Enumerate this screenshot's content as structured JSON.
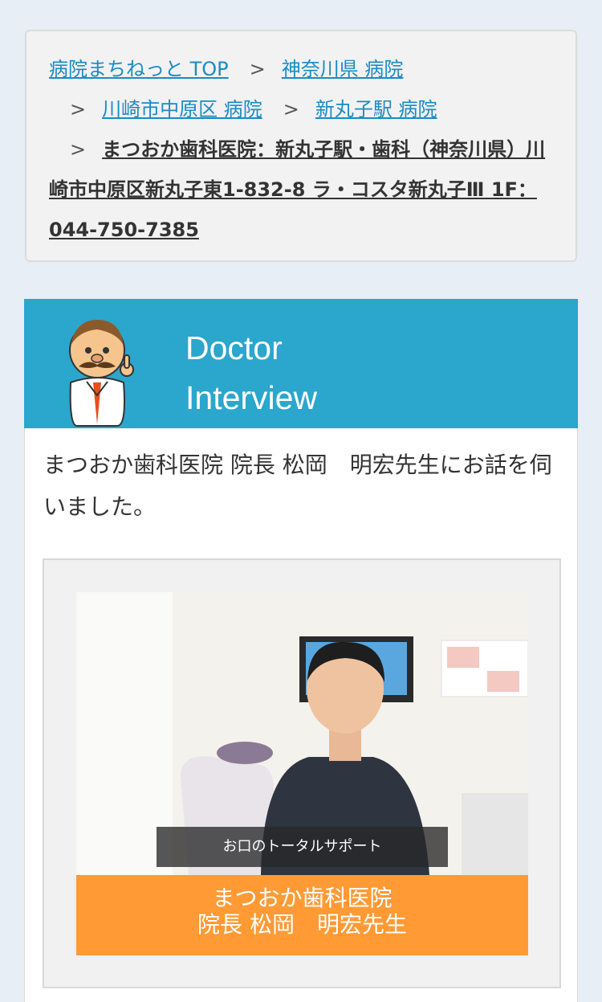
{
  "breadcrumb": {
    "items": [
      {
        "label": "病院まちねっと TOP"
      },
      {
        "label": "神奈川県 病院"
      },
      {
        "label": "川崎市中原区 病院"
      },
      {
        "label": "新丸子駅 病院"
      }
    ],
    "separator": ">",
    "current": "まつおか歯科医院：新丸子駅・歯科（神奈川県）川崎市中原区新丸子東1-832-8 ラ・コスタ新丸子Ⅲ 1F：044-750-7385"
  },
  "header": {
    "title_line1": "Doctor",
    "title_line2": "Interview",
    "background_color": "#2ba6cd",
    "mascot_icon": "doctor-mascot-icon"
  },
  "interview": {
    "intro_text": "まつおか歯科医院 院長 松岡　明宏先生にお話を伺いました。",
    "photo_caption": "お口のトータルサポート",
    "name_plate": {
      "line1": "まつおか歯科医院",
      "line2": "院長 松岡　明宏先生"
    },
    "name_plate_color": "#ff9a34"
  }
}
